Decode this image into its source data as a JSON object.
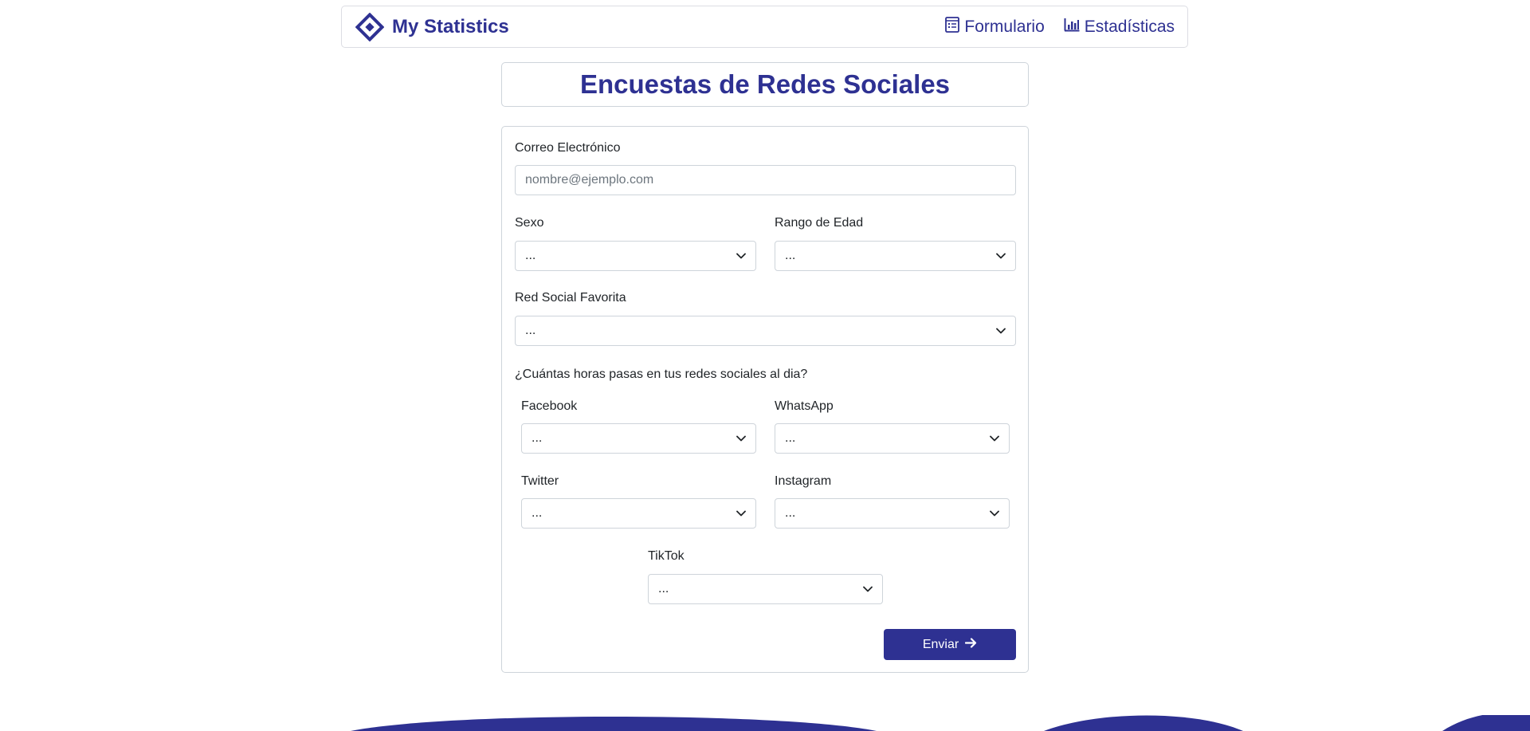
{
  "navbar": {
    "brand": "My Statistics",
    "links": [
      {
        "label": "Formulario",
        "icon": "form-icon"
      },
      {
        "label": "Estadísticas",
        "icon": "bar-chart-icon"
      }
    ]
  },
  "page_title": "Encuestas de Redes Sociales",
  "form": {
    "email": {
      "label": "Correo Electrónico",
      "placeholder": "nombre@ejemplo.com",
      "value": ""
    },
    "sex": {
      "label": "Sexo",
      "value": "..."
    },
    "age": {
      "label": "Rango de Edad",
      "value": "..."
    },
    "favorite": {
      "label": "Red Social Favorita",
      "value": "..."
    },
    "hours_question": "¿Cuántas horas pasas en tus redes sociales al dia?",
    "networks": {
      "facebook": {
        "label": "Facebook",
        "value": "..."
      },
      "whatsapp": {
        "label": "WhatsApp",
        "value": "..."
      },
      "twitter": {
        "label": "Twitter",
        "value": "..."
      },
      "instagram": {
        "label": "Instagram",
        "value": "..."
      },
      "tiktok": {
        "label": "TikTok",
        "value": "..."
      }
    },
    "submit_label": "Enviar"
  },
  "colors": {
    "primary": "#2e3192",
    "border": "#ced4da",
    "background": "#ffffff"
  }
}
